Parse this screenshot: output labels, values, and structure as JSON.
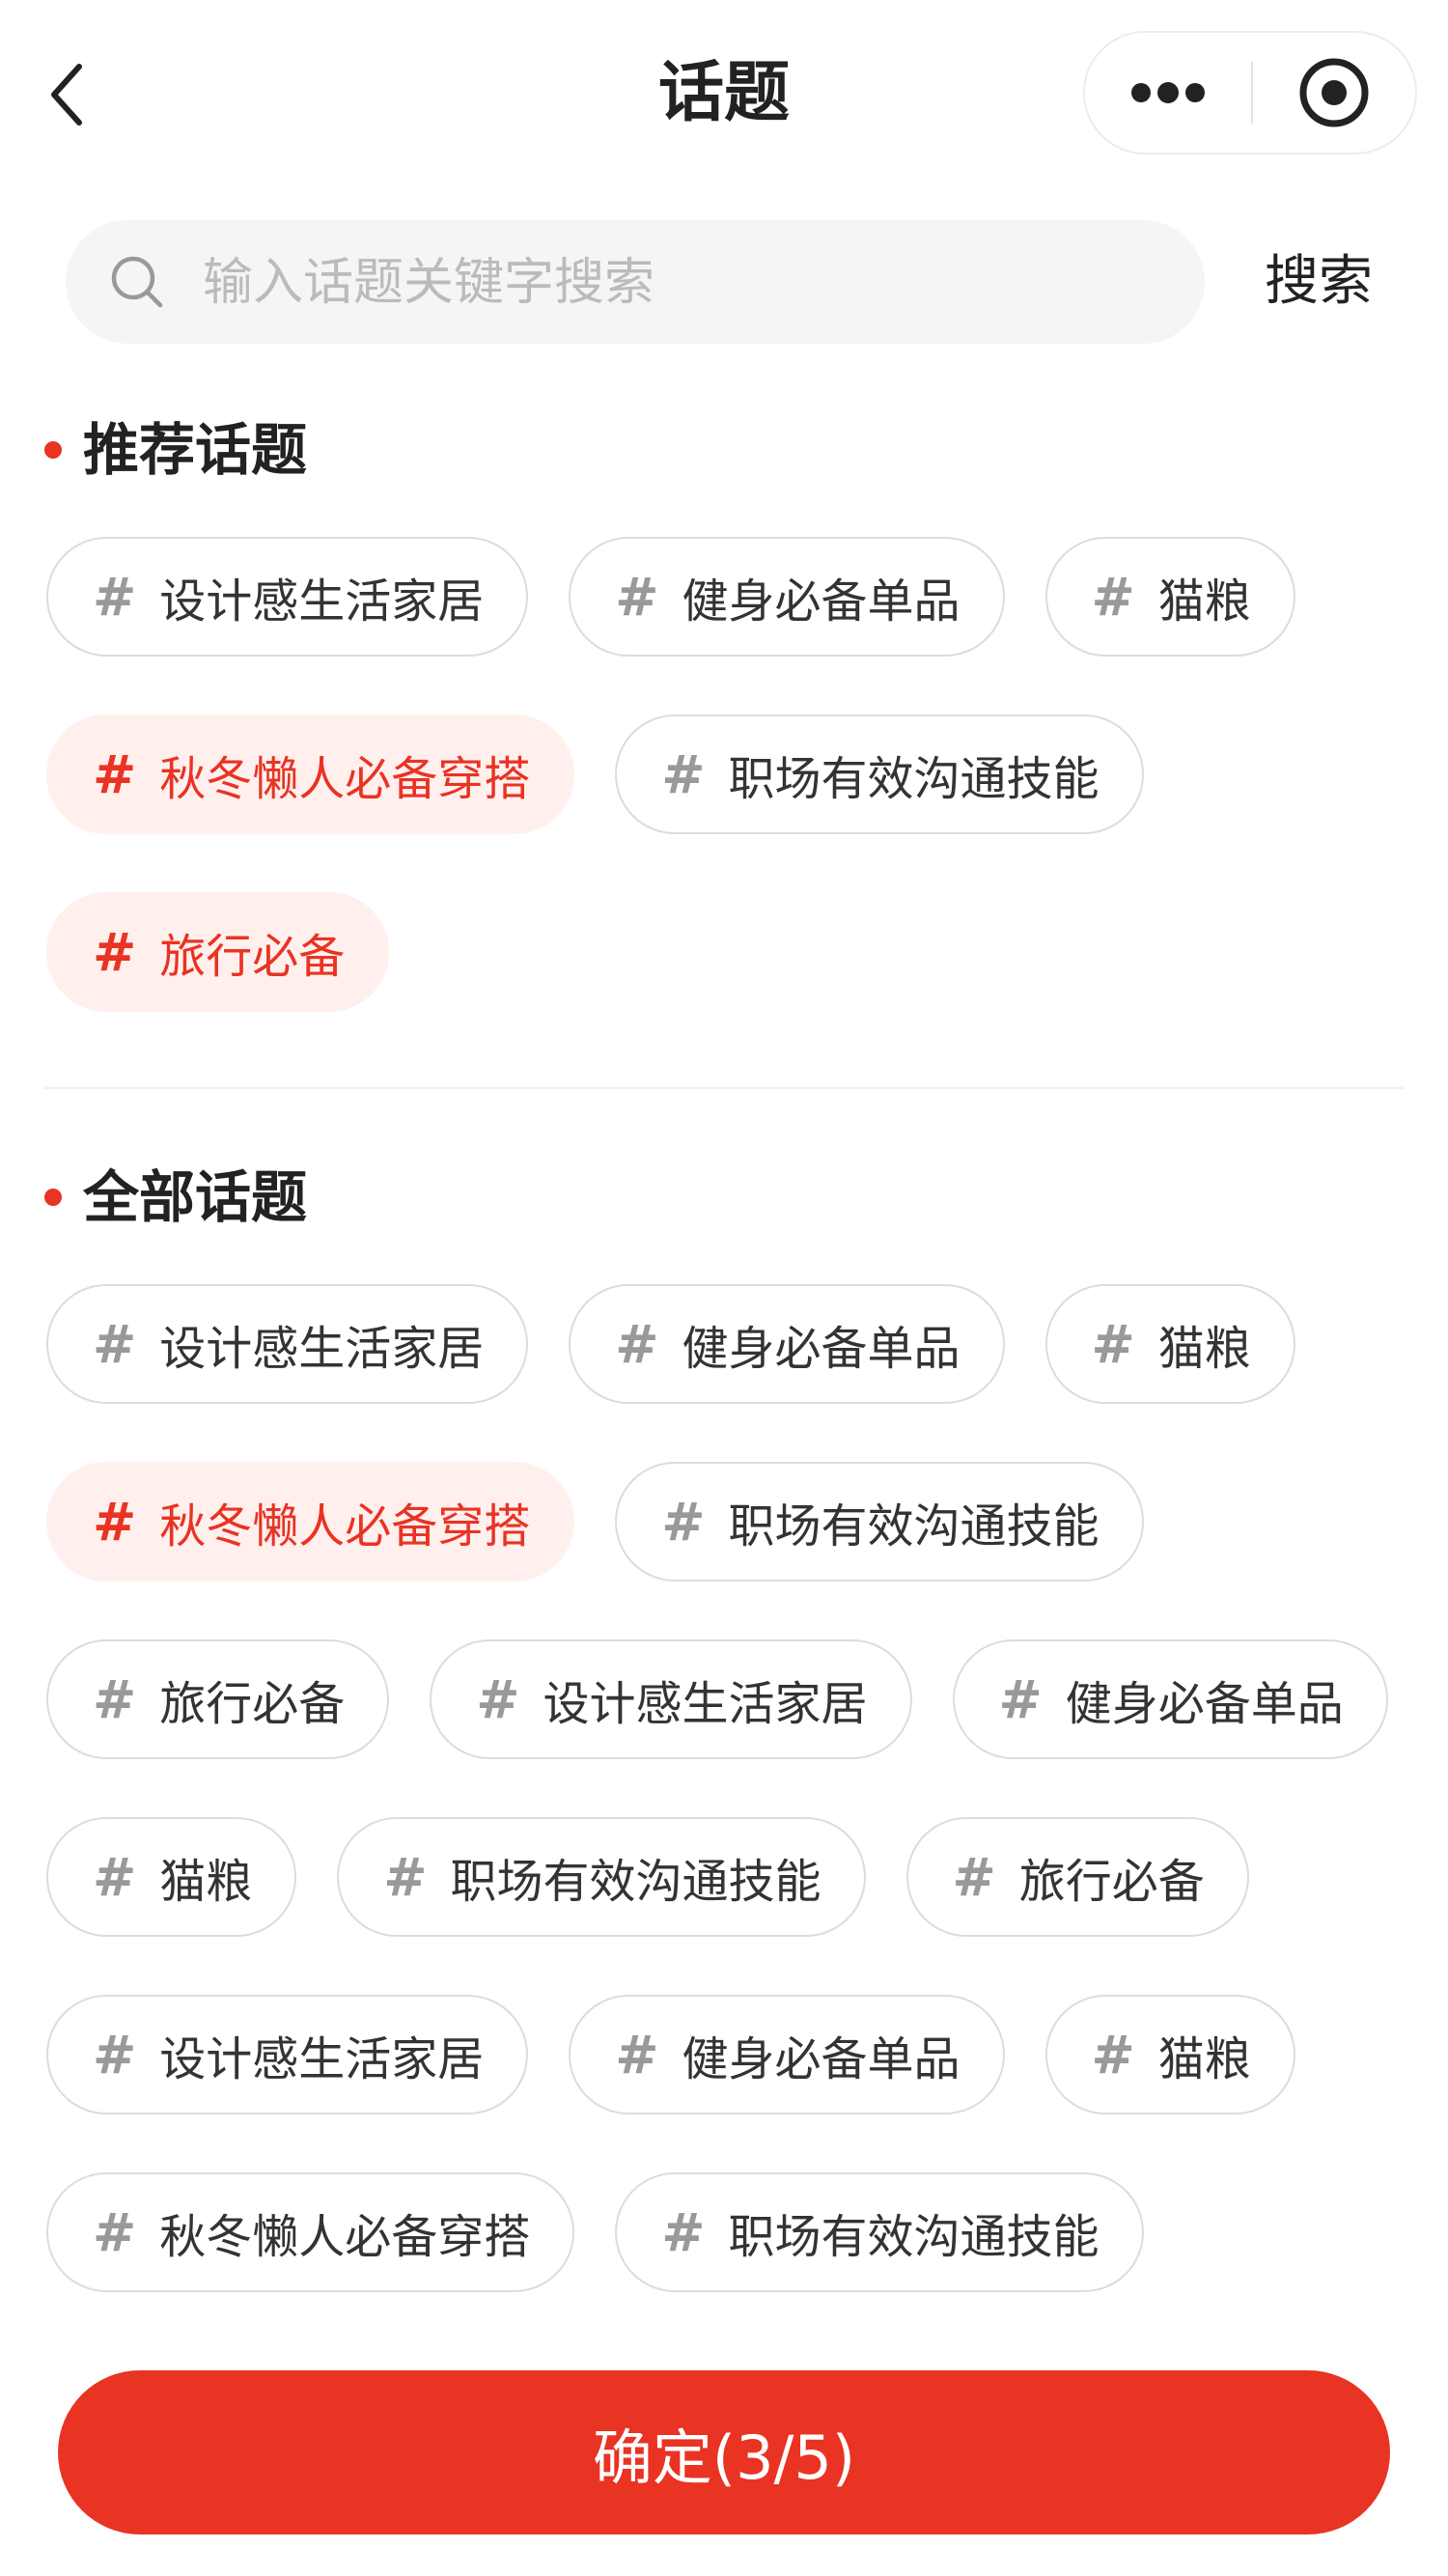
{
  "nav": {
    "title": "话题"
  },
  "search": {
    "placeholder": "输入话题关键字搜索",
    "button_label": "搜索"
  },
  "recommended": {
    "title": "推荐话题",
    "tags": [
      {
        "label": "设计感生活家居",
        "selected": false
      },
      {
        "label": "健身必备单品",
        "selected": false
      },
      {
        "label": "猫粮",
        "selected": false
      },
      {
        "label": "秋冬懒人必备穿搭",
        "selected": true
      },
      {
        "label": "职场有效沟通技能",
        "selected": false
      },
      {
        "label": "旅行必备",
        "selected": true
      }
    ]
  },
  "all": {
    "title": "全部话题",
    "tags": [
      {
        "label": "设计感生活家居",
        "selected": false
      },
      {
        "label": "健身必备单品",
        "selected": false
      },
      {
        "label": "猫粮",
        "selected": false
      },
      {
        "label": "秋冬懒人必备穿搭",
        "selected": true
      },
      {
        "label": "职场有效沟通技能",
        "selected": false
      },
      {
        "label": "旅行必备",
        "selected": false
      },
      {
        "label": "设计感生活家居",
        "selected": false
      },
      {
        "label": "健身必备单品",
        "selected": false
      },
      {
        "label": "猫粮",
        "selected": false
      },
      {
        "label": "职场有效沟通技能",
        "selected": false
      },
      {
        "label": "旅行必备",
        "selected": false
      },
      {
        "label": "设计感生活家居",
        "selected": false
      },
      {
        "label": "健身必备单品",
        "selected": false
      },
      {
        "label": "猫粮",
        "selected": false
      },
      {
        "label": "秋冬懒人必备穿搭",
        "selected": false
      },
      {
        "label": "职场有效沟通技能",
        "selected": false
      }
    ]
  },
  "tag_prefix": "#",
  "confirm": {
    "label": "确定(3/5)"
  },
  "colors": {
    "accent": "#e93323",
    "selected_bg": "#fff0ee",
    "tag_border": "#dcdcdc",
    "hash_gray": "#999999"
  }
}
